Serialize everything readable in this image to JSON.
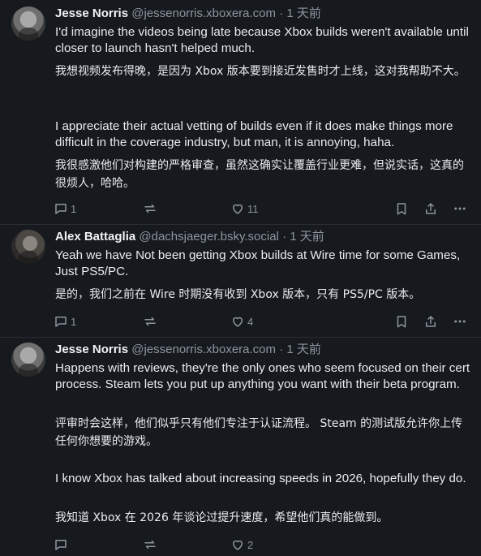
{
  "posts": [
    {
      "author_name": "Jesse Norris",
      "author_handle": "@jessenorris.xboxera.com",
      "separator": "·",
      "time": "1 天前",
      "paragraphs": [
        "I'd imagine the videos being late because Xbox builds weren't available until closer to launch hasn't helped much.",
        "我想视频发布得晚，是因为 Xbox 版本要到接近发售时才上线，这对我帮助不大。",
        "I appreciate their actual vetting of builds even if it does make things more difficult in the coverage industry, but man, it is annoying, haha.",
        "我很感激他们对构建的严格审查，虽然这确实让覆盖行业更难，但说实话，这真的很烦人，哈哈。"
      ],
      "reply_count": "1",
      "repost_count": "",
      "like_count": "11"
    },
    {
      "author_name": "Alex Battaglia",
      "author_handle": "@dachsjaeger.bsky.social",
      "separator": "·",
      "time": "1 天前",
      "paragraphs": [
        "Yeah we have Not been getting Xbox builds at Wire time for some Games, Just PS5/PC.",
        "是的，我们之前在 Wire 时期没有收到 Xbox 版本，只有 PS5/PC 版本。"
      ],
      "reply_count": "1",
      "repost_count": "",
      "like_count": "4"
    },
    {
      "author_name": "Jesse Norris",
      "author_handle": "@jessenorris.xboxera.com",
      "separator": "·",
      "time": "1 天前",
      "paragraphs": [
        "Happens with reviews, they're the only ones who seem focused on their cert process.  Steam lets you put up anything you want with their beta program.",
        "评审时会这样，他们似乎只有他们专注于认证流程。 Steam 的测试版允许你上传任何你想要的游戏。",
        "I know Xbox has talked about increasing speeds in 2026, hopefully they do.",
        "我知道 Xbox 在 2026 年谈论过提升速度，希望他们真的能做到。"
      ],
      "reply_count": "",
      "repost_count": "",
      "like_count": "2"
    }
  ],
  "icons": {
    "reply": "speech-bubble-icon",
    "repost": "repost-arrows-icon",
    "like": "heart-icon",
    "bookmark": "bookmark-icon",
    "share": "share-icon",
    "more": "more-dots-icon"
  },
  "colors": {
    "background": "#16191d",
    "text": "#e9ecef",
    "muted": "#8d96a0"
  }
}
